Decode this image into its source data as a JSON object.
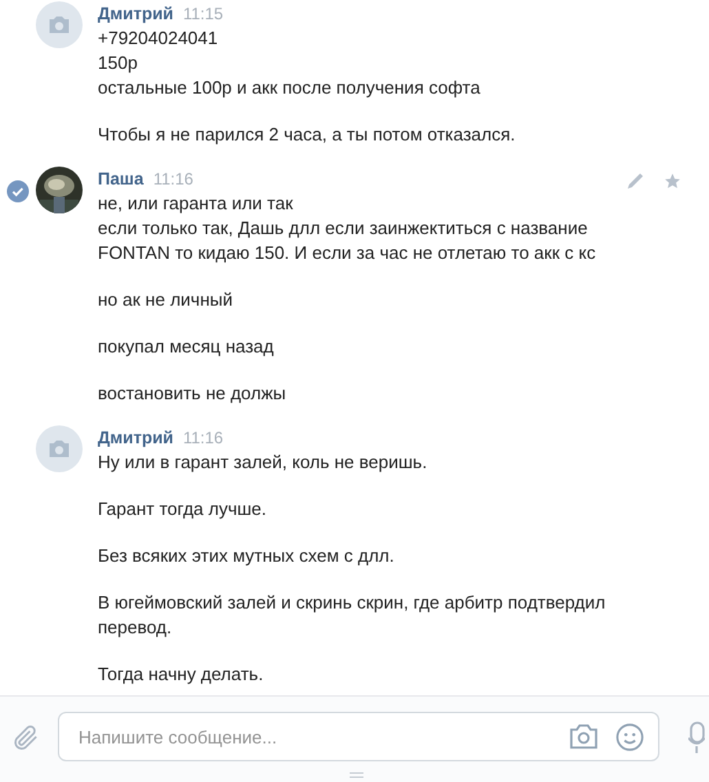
{
  "messages": [
    {
      "author": "Дмитрий",
      "time": "11:15",
      "selected": false,
      "paragraphs": [
        [
          "+79204024041",
          "150р",
          "остальные 100р и акк после получения софта"
        ],
        [
          "Чтобы я не парился 2 часа, а ты потом отказался."
        ]
      ]
    },
    {
      "author": "Паша",
      "time": "11:16",
      "avatar": {
        "kind": "picture"
      },
      "selected": true,
      "paragraphs": [
        [
          "не, или гаранта или так",
          "если только так, Дашь длл если заинжектиться с название FONTAN то кидаю 150. И если за час не отлетаю то акк с кс"
        ],
        [
          "но ак не личный"
        ],
        [
          "покупал месяц назад"
        ],
        [
          "востановить не должы"
        ]
      ]
    },
    {
      "author": "Дмитрий",
      "time": "11:16",
      "selected": false,
      "paragraphs": [
        [
          "Ну или в гарант залей, коль не веришь."
        ],
        [
          "Гарант тогда лучше."
        ],
        [
          "Без всяких этих мутных схем с длл."
        ],
        [
          "В югеймовский залей и скринь скрин, где арбитр подтвердил перевод."
        ],
        [
          "Тогда начну делать."
        ]
      ]
    }
  ],
  "composer": {
    "placeholder": "Напишите сообщение..."
  }
}
